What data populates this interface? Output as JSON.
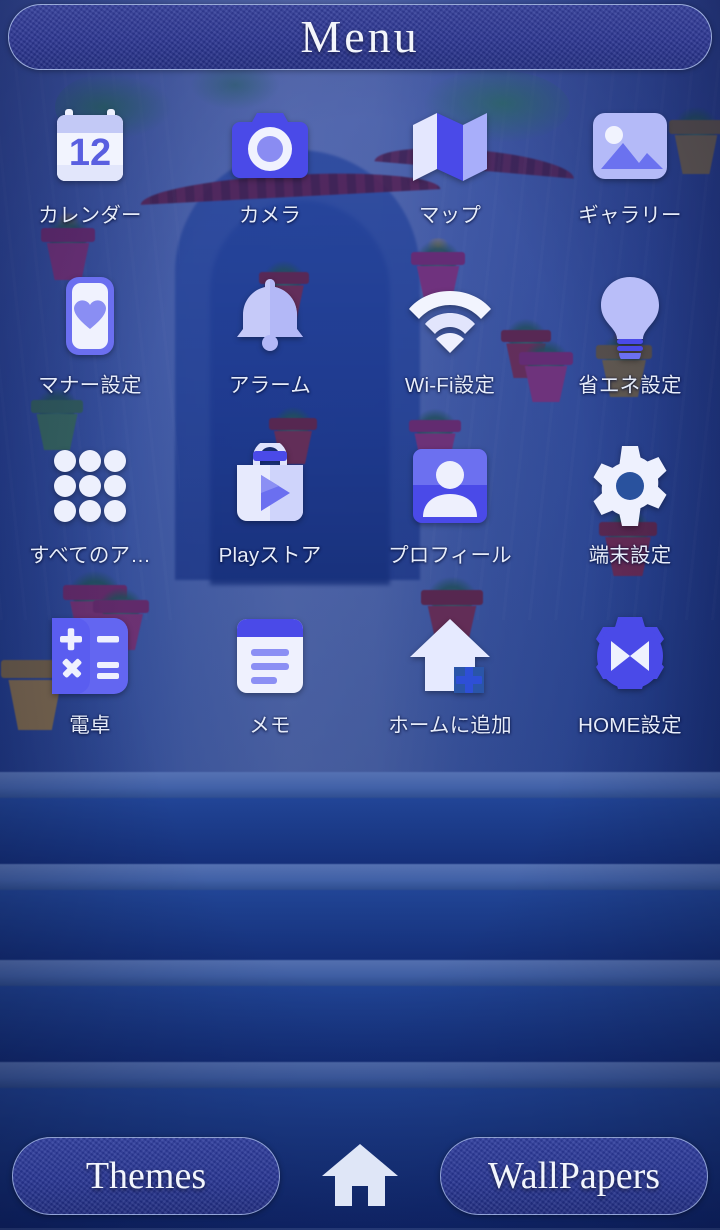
{
  "header": {
    "title": "Menu",
    "icon": "menu-header-pill"
  },
  "colors": {
    "accent_blue": "#4a4ae8",
    "icon_light": "#c9cdfa",
    "icon_white": "#eef1fe",
    "pill_fill": "#2c3691",
    "pill_border": "#bed2f5",
    "label_text": "#e6ecfa",
    "background_blue": "#27529f"
  },
  "apps": [
    {
      "label": "カレンダー",
      "icon": "calendar-icon",
      "badge": "12"
    },
    {
      "label": "カメラ",
      "icon": "camera-icon"
    },
    {
      "label": "マップ",
      "icon": "map-icon"
    },
    {
      "label": "ギャラリー",
      "icon": "gallery-icon"
    },
    {
      "label": "マナー設定",
      "icon": "manner-mode-icon"
    },
    {
      "label": "アラーム",
      "icon": "alarm-bell-icon"
    },
    {
      "label": "Wi-Fi設定",
      "icon": "wifi-icon"
    },
    {
      "label": "省エネ設定",
      "icon": "lightbulb-icon"
    },
    {
      "label": "すべてのア…",
      "icon": "all-apps-grid-icon"
    },
    {
      "label": "Playストア",
      "icon": "play-store-icon"
    },
    {
      "label": "プロフィール",
      "icon": "profile-person-icon"
    },
    {
      "label": "端末設定",
      "icon": "gear-icon"
    },
    {
      "label": "電卓",
      "icon": "calculator-icon"
    },
    {
      "label": "メモ",
      "icon": "memo-note-icon"
    },
    {
      "label": "ホームに追加",
      "icon": "add-to-home-icon"
    },
    {
      "label": "HOME設定",
      "icon": "home-settings-gear-icon"
    }
  ],
  "bottom_bar": {
    "themes_label": "Themes",
    "home_icon": "home-icon",
    "wallpapers_label": "WallPapers"
  }
}
